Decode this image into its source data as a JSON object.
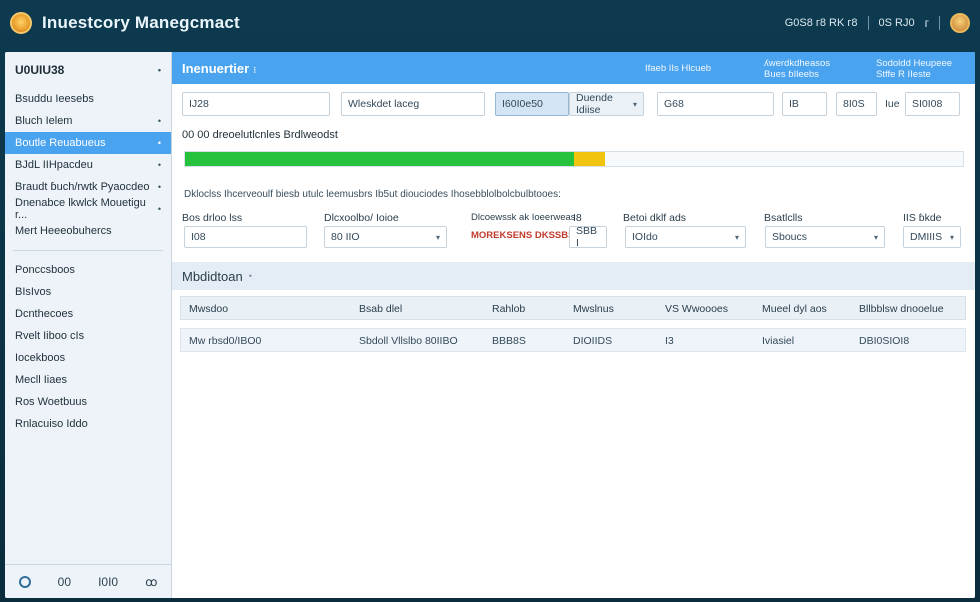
{
  "app": {
    "title": "Inuestcory Manegcmact",
    "top_right": [
      "G0S8 ᴦ8 RK ᴦ8",
      "0S RJ0",
      "ᴦ"
    ]
  },
  "sidebar": {
    "header": "U0UIU38",
    "items": [
      {
        "label": "Bsuddu Ieesebs",
        "dot": ""
      },
      {
        "label": "Bluch Ielem",
        "dot": "•"
      },
      {
        "label": "Boutle Reuabueus",
        "dot": "•"
      },
      {
        "label": "BJdL IIHpacdeu",
        "dot": "•"
      },
      {
        "label": "Braudt ɓuch/rwtk Pyaocdeo",
        "dot": "•"
      },
      {
        "label": "Dnenabce lkwlck Mouetigu r...",
        "dot": "•"
      },
      {
        "label": "Mert Heeeobuhercs",
        "dot": ""
      }
    ],
    "items2": [
      "Ponccsboos",
      "BIsIvos",
      "Dcnthecoes",
      "Rvelt Iiboo cIs",
      "Iocekboos",
      "Mecll Iiaes",
      "Ros Woetbuus",
      "Rnlacuiso Iddo"
    ],
    "footer": [
      "O8",
      "00",
      "I0I0",
      "ꝏ"
    ]
  },
  "main": {
    "header_title": "Inenuertier",
    "header_cols": [
      {
        "l1": "Ifaeb IIs Hlcueb",
        "l2": ""
      },
      {
        "l1": "ʎwerdkdheasos",
        "l2": "Bues ɓIleebs"
      },
      {
        "l1": "Sodoldd Heupeee",
        "l2": "Stffe R IIeste"
      }
    ],
    "filters": {
      "f1": "IJ28",
      "f2": "Wleskdet laceg",
      "tab1": "I60I0e50",
      "tab2": "Duende Idiise",
      "f3": "G68",
      "f4": "IB",
      "f5": "8I0S",
      "f6_label": "Iue",
      "f6": "SI0I08"
    },
    "progress_label": "00 00 dreoelutlcnles Brdlweodst",
    "progress_green": 0.5,
    "progress_yellow": 0.04,
    "note": "Dkloclss Ihcerveoulf biesb utulc leemusbrs Ib5ut diouciodes Ihosebblolbolcbulbtooes:",
    "fields": [
      {
        "label": "Bos drloo lss",
        "value": "I08"
      },
      {
        "label": "Dlcxoolbo/ Ioioe",
        "value": "80 IIO"
      },
      {
        "label": "Dlcoewssk ak Ioeerweas",
        "value": "MOREKSENS DKSSBSSGOIIS"
      },
      {
        "label": "I8",
        "value": "SBB I"
      },
      {
        "label": "Betoi dklf ads",
        "value": "IOIdo"
      },
      {
        "label": "Bsatlclls",
        "value": "Sboucs"
      },
      {
        "label": "IIS ɓkde",
        "value": "DMIIIS"
      }
    ],
    "section_title": "Mbdidtoan",
    "table": {
      "headers": [
        "Mwsdoo",
        "Bsab dlel",
        "Rahlob",
        "Mwslnus",
        "VS Wwoooes",
        "Mueel dyl aos",
        "Bllbblsw dnooelue"
      ],
      "rows": [
        [
          "Mw rbsd0/IBO0",
          "Sbdoll Vllslbo 80IIBO",
          "BBB8S",
          "DIOIIDS",
          "I3",
          "Iviasiel",
          "DBI0SIOI8"
        ]
      ]
    }
  },
  "colors": {
    "accent": "#4aa3ef",
    "progress_green": "#27c23d",
    "progress_yellow": "#f1c40f",
    "warning_text": "#c0392b"
  }
}
